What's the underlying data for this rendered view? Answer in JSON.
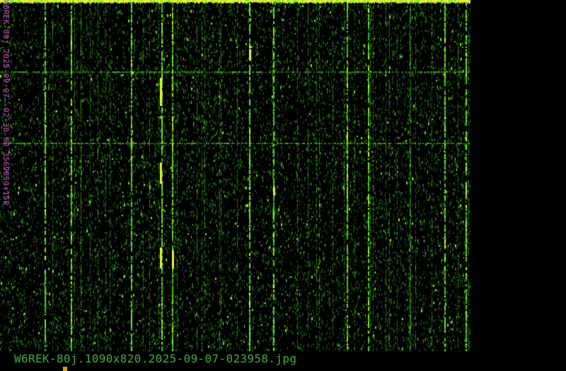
{
  "image": {
    "filename": "W6REK-80j.1090x820.2025-09-07-023958.jpg",
    "side_label": "W6REK-80j 2025-09-07--02-30-00 3569850+150"
  },
  "colors": {
    "background": "#000000",
    "signal_green": "#3fbf1a",
    "bright_green": "#7fe81f",
    "signal_yellow": "#e6f03a",
    "filename_text": "#3fae3a",
    "side_text": "#c050c0",
    "cursor_mark": "#d4a017"
  }
}
